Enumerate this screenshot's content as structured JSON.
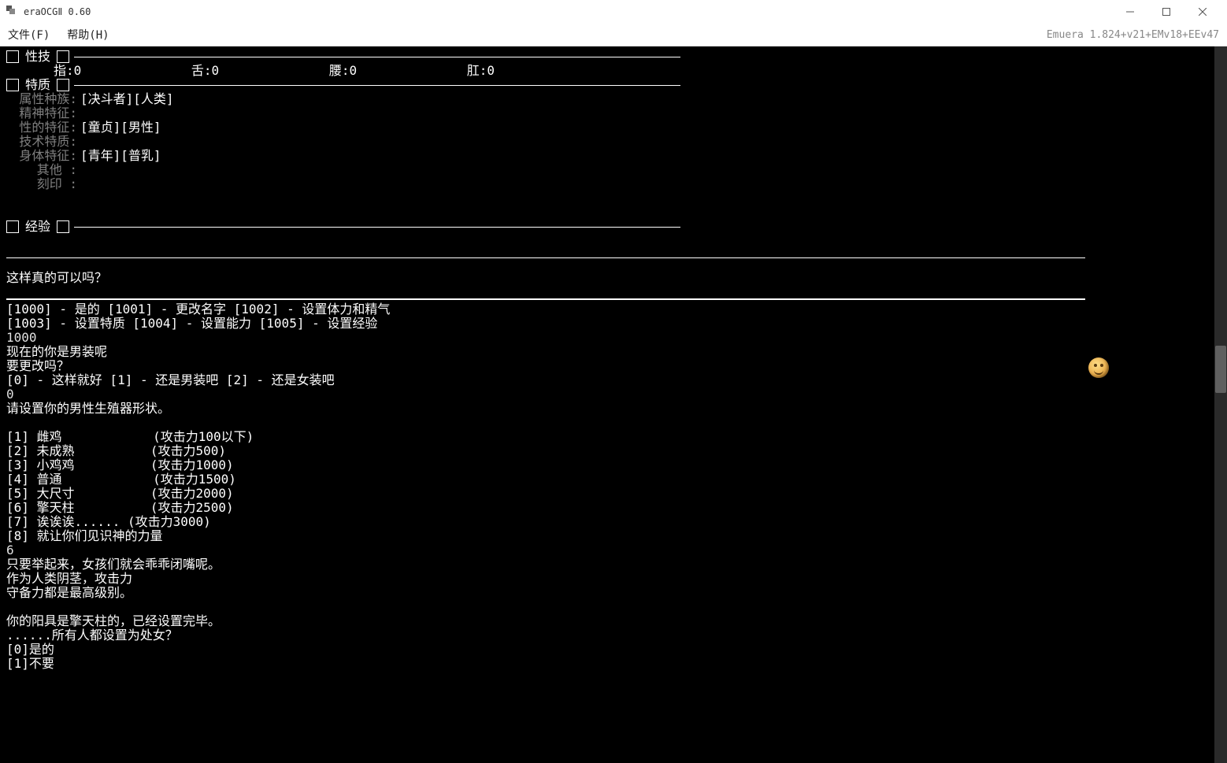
{
  "window": {
    "title": "eraOCGⅡ 0.60",
    "version": "Emuera 1.824+v21+EMv18+EEv47"
  },
  "menu": {
    "file": "文件(F)",
    "help": "帮助(H)"
  },
  "sections": {
    "skill": "性技",
    "trait": "特质",
    "exp": "经验"
  },
  "skill_stats": {
    "finger": "指:0",
    "tongue": "舌:0",
    "waist": "腰:0",
    "anus": "肛:0"
  },
  "traits": {
    "race_label": "属性种族:",
    "race_value": "[决斗者][人类]",
    "mental_label": "精神特征:",
    "mental_value": "",
    "sexual_label": "性的特征:",
    "sexual_value": "[童贞][男性]",
    "tech_label": "技术特质:",
    "tech_value": "",
    "body_label": "身体特征:",
    "body_value": "[青年][普乳]",
    "other_label": "其他  :",
    "other_value": "",
    "mark_label": "刻印  :",
    "mark_value": ""
  },
  "dialog": {
    "confirm": "这样真的可以吗？",
    "line1": "[1000] - 是的  [1001] - 更改名字  [1002] - 设置体力和精气",
    "line2": "[1003] - 设置特质  [1004] - 设置能力  [1005] - 设置经验",
    "input1": "1000",
    "now_male": "现在的你是男装呢",
    "change_q": "要更改吗？",
    "cloth_opts": "[0] - 这样就好 [1] - 还是男装吧 [2] - 还是女装吧",
    "input2": "0",
    "set_organ": "请设置你的男性生殖器形状。",
    "opts": [
      "[1] 雌鸡            (攻击力100以下)",
      "[2] 未成熟          (攻击力500)",
      "[3] 小鸡鸡          (攻击力1000)",
      "[4] 普通            (攻击力1500)",
      "[5] 大尺寸          (攻击力2000)",
      "[6] 擎天柱          (攻击力2500)",
      "[7] 诶诶诶...... (攻击力3000)",
      "[8] 就让你们见识神的力量"
    ],
    "input3": "6",
    "react1": "只要举起来，女孩们就会乖乖闭嘴呢。",
    "react2": "作为人类阴茎，攻击力",
    "react3": "守备力都是最高级别。",
    "done": "你的阳具是擎天柱的，已经设置完毕。",
    "virgin_q": "......所有人都设置为处女？",
    "virgin_yes": "[0]是的",
    "virgin_no": "[1]不要"
  }
}
